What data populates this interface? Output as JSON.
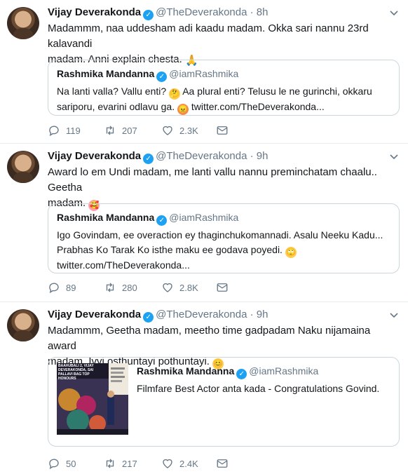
{
  "tweets": [
    {
      "name": "Vijay Deverakonda",
      "handle": "@TheDeverakonda",
      "time": "8h",
      "text1": "Madammm, naa uddesham adi kaadu madam. Okka sari nannu 23rd kalavandi",
      "text2": "madam. Anni explain chesta.",
      "quote": {
        "name": "Rashmika Mandanna",
        "handle": "@iamRashmika",
        "line1": "Na lanti valla? Vallu enti?",
        "line1b": "Aa plural enti? Telusu le ne gurinchi, okkaru",
        "line2": "sariporu, evarini odlavu ga.",
        "line2b": "twitter.com/TheDeverakonda..."
      },
      "replies": "119",
      "retweets": "207",
      "likes": "2.3K"
    },
    {
      "name": "Vijay Deverakonda",
      "handle": "@TheDeverakonda",
      "time": "9h",
      "text1": "Award lo em Undi madam, me lanti vallu nannu preminchatam chaalu.. Geetha",
      "text2": "madam.",
      "quote": {
        "name": "Rashmika Mandanna",
        "handle": "@iamRashmika",
        "line1": "Igo Govindam, ee overaction ey thaginchukomannadi. Asalu Neeku Kadu...",
        "line2": "Prabhas Ko Tarak Ko isthe maku ee godava poyedi.",
        "line3": "twitter.com/TheDeverakonda..."
      },
      "replies": "89",
      "retweets": "280",
      "likes": "2.8K"
    },
    {
      "name": "Vijay Deverakonda",
      "handle": "@TheDeverakonda",
      "time": "9h",
      "text1": "Madammm, Geetha madam, meetho time gadpadam Naku nijamaina award",
      "text2": "madam. Ivvi osthuntayi pothuntayi.",
      "quote": {
        "name": "Rashmika Mandanna",
        "handle": "@iamRashmika",
        "line1": "Filmfare Best Actor anta kada - Congratulations Govind.",
        "image_text": "BAAHUBALI 2, VIJAY DEVERAKONDA, SAI PALLAVI BAG TOP HONOURS"
      },
      "replies": "50",
      "retweets": "217",
      "likes": "2.4K"
    }
  ],
  "colors": {
    "accent": "#1da1f2",
    "muted": "#657786",
    "border": "#ccd6dd"
  },
  "icons": [
    "reply-icon",
    "retweet-icon",
    "like-icon",
    "message-icon",
    "verified-icon",
    "caret-down-icon"
  ]
}
